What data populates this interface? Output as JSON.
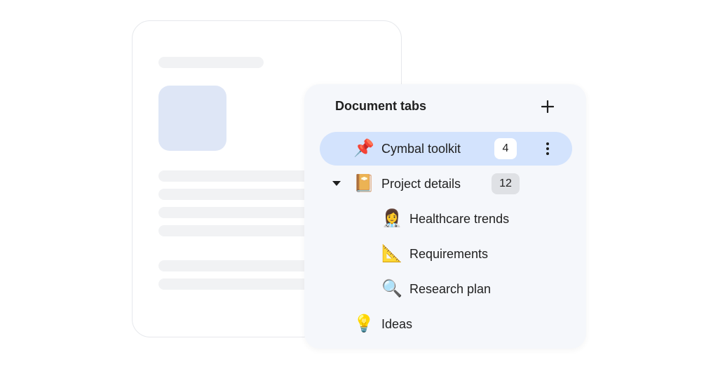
{
  "panel": {
    "title": "Document tabs",
    "add_icon": "plus-icon",
    "tabs": [
      {
        "emoji": "📌",
        "icon": "pushpin-icon",
        "label": "Cymbal toolkit",
        "badge": "4",
        "selected": true
      },
      {
        "emoji": "📔",
        "icon": "notebook-icon",
        "label": "Project details",
        "badge": "12",
        "expanded": true
      },
      {
        "emoji": "👩‍⚕️",
        "icon": "health-worker-icon",
        "label": "Healthcare trends"
      },
      {
        "emoji": "📐",
        "icon": "triangular-ruler-icon",
        "label": "Requirements"
      },
      {
        "emoji": "🔍",
        "icon": "magnifying-glass-icon",
        "label": "Research plan"
      },
      {
        "emoji": "💡",
        "icon": "light-bulb-icon",
        "label": "Ideas"
      }
    ]
  },
  "colors": {
    "selected_row": "#d3e3fd",
    "panel_bg": "#f5f7fb",
    "image_placeholder": "#dee6f6",
    "skeleton": "#f1f2f4",
    "badge_grey": "#dfe1e5"
  }
}
